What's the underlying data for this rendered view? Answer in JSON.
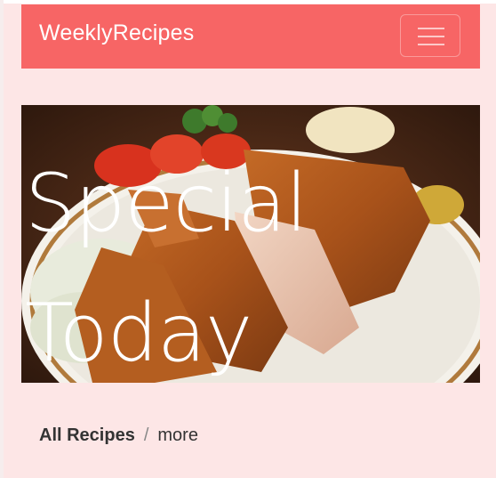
{
  "navbar": {
    "brand": "WeeklyRecipes",
    "toggle_icon": "hamburger-icon",
    "background_color": "#f76565"
  },
  "hero": {
    "title_line1": "Special",
    "title_line2": "Today",
    "image": "fried-pork-cutlet-plate"
  },
  "breadcrumb": {
    "items": [
      {
        "label": "All Recipes"
      },
      {
        "label": "more"
      }
    ],
    "separator": "/"
  },
  "colors": {
    "page_background": "#fde6e6",
    "accent": "#f76565"
  }
}
